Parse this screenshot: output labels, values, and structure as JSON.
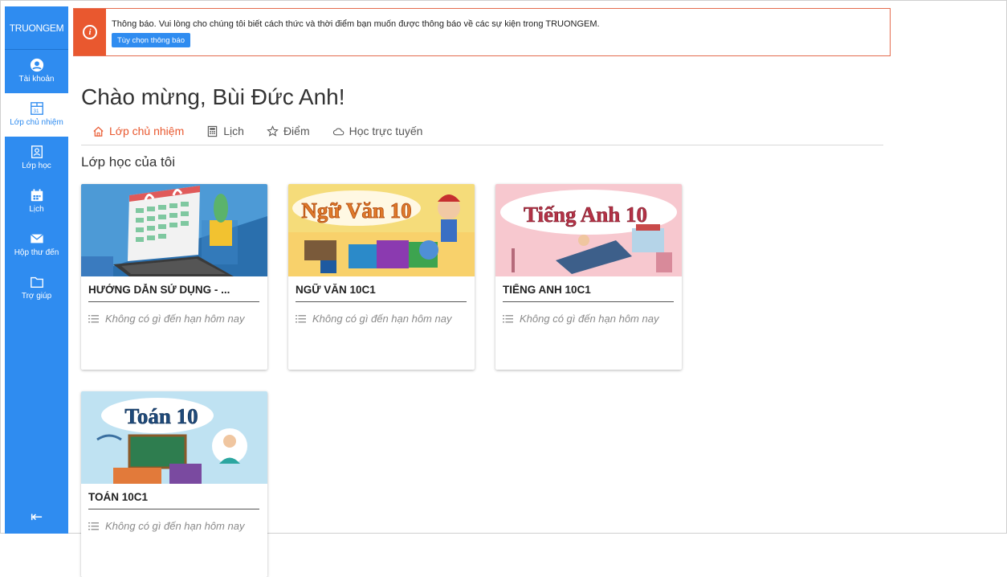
{
  "sidebar": {
    "brand": "TRUONGEM",
    "items": [
      {
        "label": "Tài khoản",
        "icon": "account-icon"
      },
      {
        "label": "Lớp chủ nhiệm",
        "icon": "homeroom-icon"
      },
      {
        "label": "Lớp học",
        "icon": "class-icon"
      },
      {
        "label": "Lịch",
        "icon": "calendar-icon"
      },
      {
        "label": "Hộp thư đến",
        "icon": "mail-icon"
      },
      {
        "label": "Trợ giúp",
        "icon": "folder-icon"
      }
    ],
    "collapse": "⇤"
  },
  "notice": {
    "text": "Thông báo.  Vui lòng cho chúng tôi biết cách thức và thời điểm bạn muốn được thông báo về các sự kiện trong TRUONGEM.",
    "button": "Tùy chọn thông báo",
    "icon": "info-icon"
  },
  "page": {
    "title": "Chào mừng, Bùi Đức Anh!",
    "tabs": [
      {
        "label": "Lớp chủ nhiệm",
        "icon": "home-icon"
      },
      {
        "label": "Lịch",
        "icon": "calculator-icon"
      },
      {
        "label": "Điểm",
        "icon": "star-icon"
      },
      {
        "label": "Học trực tuyến",
        "icon": "cloud-icon"
      }
    ],
    "section": "Lớp học của tôi"
  },
  "cards": [
    {
      "name": "HƯỚNG DẪN SỬ DỤNG - ...",
      "due": "Không có gì đến hạn hôm nay"
    },
    {
      "name": "NGỮ VĂN 10C1",
      "due": "Không có gì đến hạn hôm nay",
      "banner": "Ngữ Văn 10"
    },
    {
      "name": "TIẾNG ANH 10C1",
      "due": "Không có gì đến hạn hôm nay",
      "banner": "Tiếng Anh 10"
    },
    {
      "name": "TOÁN 10C1",
      "due": "Không có gì đến hạn hôm nay",
      "banner": "Toán 10"
    }
  ],
  "colors": {
    "primary": "#2f8cf0",
    "accent": "#e9582f"
  }
}
